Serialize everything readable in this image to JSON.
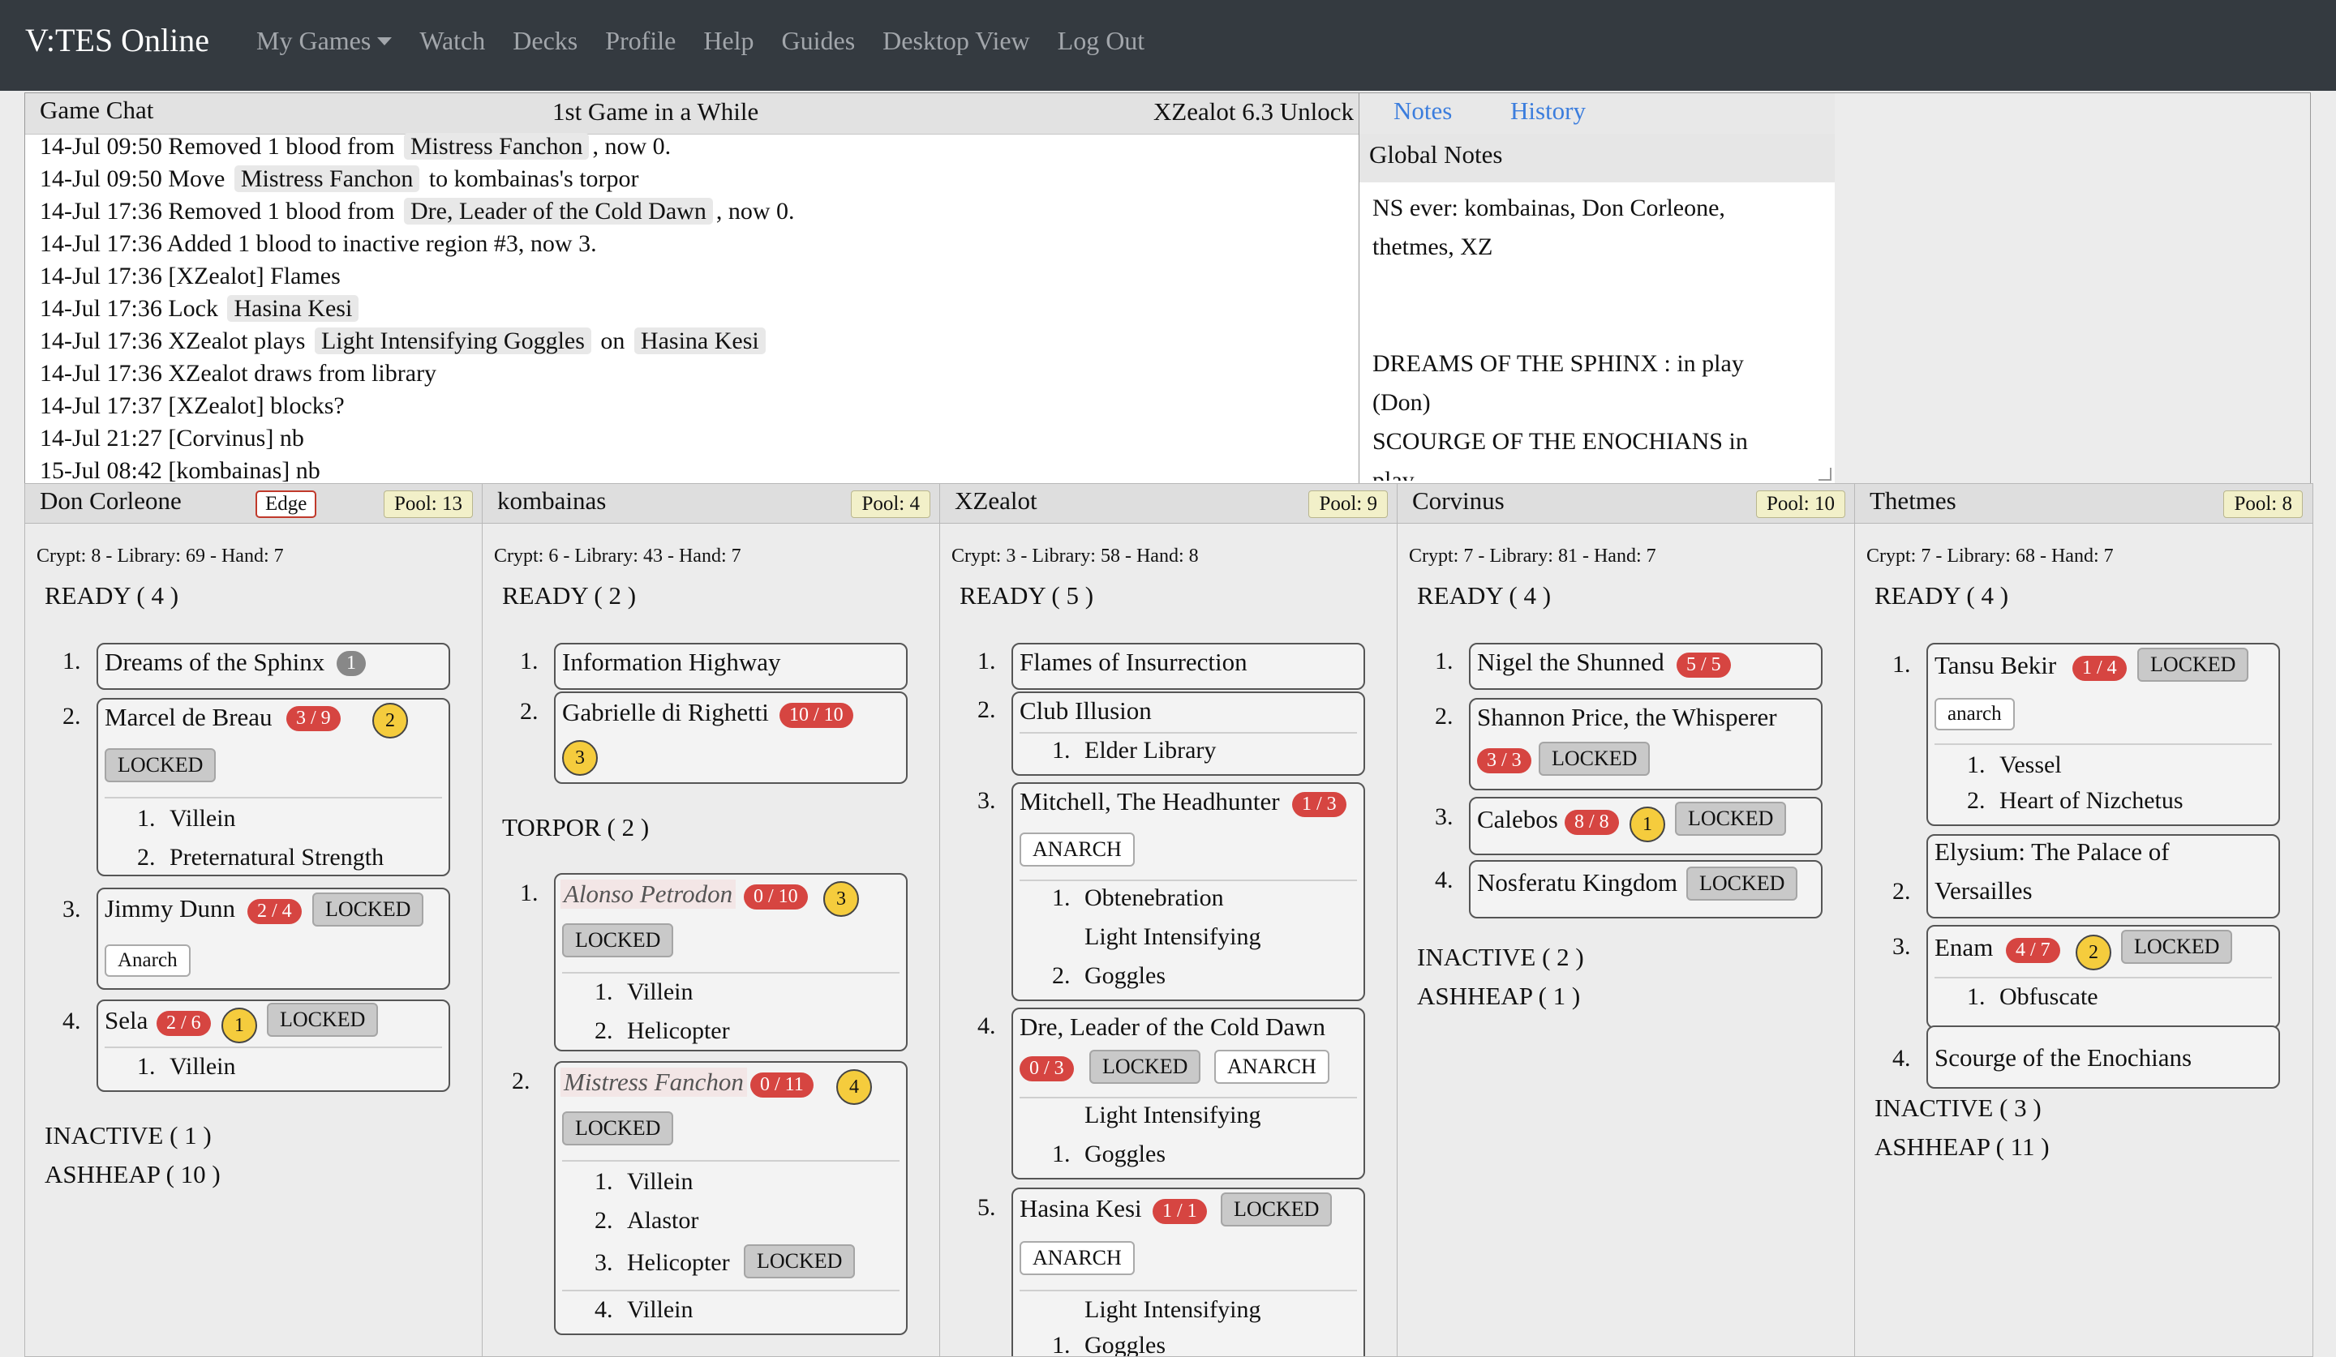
{
  "nav": {
    "brand": "V:TES Online",
    "links": [
      "My Games",
      "Watch",
      "Decks",
      "Profile",
      "Help",
      "Guides",
      "Desktop View",
      "Log Out"
    ]
  },
  "chat": {
    "title": "Game Chat",
    "game_name": "1st Game in a While",
    "version": "XZealot 6.3 Unlock",
    "lines": [
      [
        {
          "t": "14-Jul 09:50 Removed 1 blood from "
        },
        {
          "c": "Mistress Fanchon"
        },
        {
          "t": ", now 0."
        }
      ],
      [
        {
          "t": "14-Jul 09:50 Move "
        },
        {
          "c": "Mistress Fanchon"
        },
        {
          "t": " to kombainas's torpor"
        }
      ],
      [
        {
          "t": "14-Jul 17:36 Removed 1 blood from "
        },
        {
          "c": "Dre, Leader of the Cold Dawn"
        },
        {
          "t": ", now 0."
        }
      ],
      [
        {
          "t": "14-Jul 17:36 Added 1 blood to inactive region #3, now 3."
        }
      ],
      [
        {
          "t": "14-Jul 17:36 [XZealot] Flames"
        }
      ],
      [
        {
          "t": "14-Jul 17:36 Lock "
        },
        {
          "c": "Hasina Kesi"
        }
      ],
      [
        {
          "t": "14-Jul 17:36 XZealot plays "
        },
        {
          "c": "Light Intensifying Goggles"
        },
        {
          "t": " on "
        },
        {
          "c": "Hasina Kesi"
        }
      ],
      [
        {
          "t": "14-Jul 17:36 XZealot draws from library"
        }
      ],
      [
        {
          "t": "14-Jul 17:37 [XZealot] blocks?"
        }
      ],
      [
        {
          "t": "14-Jul 21:27 [Corvinus] nb"
        }
      ],
      [
        {
          "t": "15-Jul 08:42 [kombainas] nb"
        }
      ]
    ]
  },
  "notes": {
    "tab_notes": "Notes",
    "tab_history": "History",
    "label": "Global Notes",
    "text": "NS ever: kombainas, Don Corleone,\nthetmes, XZ\n\n\nDREAMS OF THE SPHINX : in play\n(Don)\nSCOURGE OF THE ENOCHIANS in\nplay"
  },
  "players": [
    {
      "name": "Don Corleone",
      "edge": "Edge",
      "pool": "Pool: 13",
      "stats": "Crypt: 8 - Library: 69 - Hand: 7",
      "regions": [
        {
          "label": "READY ( 4 )"
        },
        {
          "label": "INACTIVE ( 1 )"
        },
        {
          "label": "ASHHEAP ( 10 )"
        }
      ],
      "index": [
        "1.",
        "2.",
        "3.",
        "4."
      ],
      "cards": [
        {
          "name": "Dreams of the Sphinx",
          "counter": "1"
        },
        {
          "name": "Marcel de Breau",
          "blood": "3 / 9",
          "cap": "2",
          "lock": "LOCKED",
          "subs": [
            "Villein",
            "Preternatural Strength"
          ],
          "nums": [
            "1.",
            "2."
          ]
        },
        {
          "name": "Jimmy Dunn",
          "blood": "2 / 4",
          "lock": "LOCKED",
          "tag": "Anarch"
        },
        {
          "name": "Sela",
          "blood": "2 / 6",
          "cap": "1",
          "lock": "LOCKED",
          "subs": [
            "Villein"
          ],
          "nums": [
            "1."
          ]
        }
      ]
    },
    {
      "name": "kombainas",
      "pool": "Pool: 4",
      "stats": "Crypt: 6 - Library: 43 - Hand: 7",
      "regions": [
        {
          "label": "READY ( 2 )"
        },
        {
          "label": "TORPOR ( 2 )"
        }
      ],
      "index": [
        "1.",
        "2.",
        "1.",
        "2."
      ],
      "cards": [
        {
          "name": "Information Highway"
        },
        {
          "name": "Gabrielle di Righetti",
          "blood": "10 / 10",
          "cap": "3"
        },
        {
          "name": "Alonso Petrodon",
          "blood": "0 / 10",
          "cap": "3",
          "lock": "LOCKED",
          "subs": [
            "Villein",
            "Helicopter"
          ],
          "nums": [
            "1.",
            "2."
          ]
        },
        {
          "name": "Mistress Fanchon",
          "blood": "0 / 11",
          "cap": "4",
          "lock": "LOCKED",
          "subs": [
            "Villein",
            "Alastor",
            "Helicopter",
            "Villein"
          ],
          "nums": [
            "1.",
            "2.",
            "3.",
            "4."
          ],
          "sublock": "LOCKED"
        }
      ]
    },
    {
      "name": "XZealot",
      "pool": "Pool: 9",
      "stats": "Crypt: 3 - Library: 58 - Hand: 8",
      "regions": [
        {
          "label": "READY ( 5 )"
        }
      ],
      "index": [
        "1.",
        "2.",
        "3.",
        "4.",
        "5."
      ],
      "cards": [
        {
          "name": "Flames of Insurrection"
        },
        {
          "name": "Club Illusion",
          "subs": [
            "Elder Library"
          ],
          "nums": [
            "1."
          ]
        },
        {
          "name": "Mitchell, The Headhunter",
          "blood": "1 / 3",
          "tag": "ANARCH",
          "subs": [
            "Obtenebration",
            "Light Intensifying",
            "Goggles"
          ],
          "nums": [
            "1.",
            "2."
          ]
        },
        {
          "name": "Dre, Leader of the Cold Dawn",
          "blood": "0 / 3",
          "lock": "LOCKED",
          "tag": "ANARCH",
          "subs": [
            "Light Intensifying",
            "Goggles"
          ],
          "nums": [
            "1."
          ]
        },
        {
          "name": "Hasina Kesi",
          "blood": "1 / 1",
          "lock": "LOCKED",
          "tag": "ANARCH",
          "subs": [
            "Light Intensifying",
            "Goggles"
          ],
          "nums": [
            "1."
          ]
        }
      ]
    },
    {
      "name": "Corvinus",
      "pool": "Pool: 10",
      "stats": "Crypt: 7 - Library: 81 - Hand: 7",
      "regions": [
        {
          "label": "READY ( 4 )"
        },
        {
          "label": "INACTIVE ( 2 )"
        },
        {
          "label": "ASHHEAP ( 1 )"
        }
      ],
      "index": [
        "1.",
        "2.",
        "3.",
        "4."
      ],
      "cards": [
        {
          "name": "Nigel the Shunned",
          "blood": "5 / 5"
        },
        {
          "name": "Shannon Price, the Whisperer",
          "blood": "3 / 3",
          "lock": "LOCKED"
        },
        {
          "name": "Calebos",
          "blood": "8 / 8",
          "cap": "1",
          "lock": "LOCKED"
        },
        {
          "name": "Nosferatu Kingdom",
          "lock": "LOCKED"
        }
      ]
    },
    {
      "name": "Thetmes",
      "pool": "Pool: 8",
      "stats": "Crypt: 7 - Library: 68 - Hand: 7",
      "regions": [
        {
          "label": "READY ( 4 )"
        },
        {
          "label": "INACTIVE ( 3 )"
        },
        {
          "label": "ASHHEAP ( 11 )"
        }
      ],
      "index": [
        "1.",
        "2.",
        "3.",
        "4."
      ],
      "cards": [
        {
          "name": "Tansu Bekir",
          "blood": "1 / 4",
          "lock": "LOCKED",
          "tag": "anarch",
          "subs": [
            "Vessel",
            "Heart of Nizchetus"
          ],
          "nums": [
            "1.",
            "2."
          ]
        },
        {
          "name": "Elysium: The Palace of",
          "name2": "Versailles"
        },
        {
          "name": "Enam",
          "blood": "4 / 7",
          "cap": "2",
          "lock": "LOCKED",
          "subs": [
            "Obfuscate"
          ],
          "nums": [
            "1."
          ]
        },
        {
          "name": "Scourge of the Enochians"
        }
      ]
    }
  ]
}
